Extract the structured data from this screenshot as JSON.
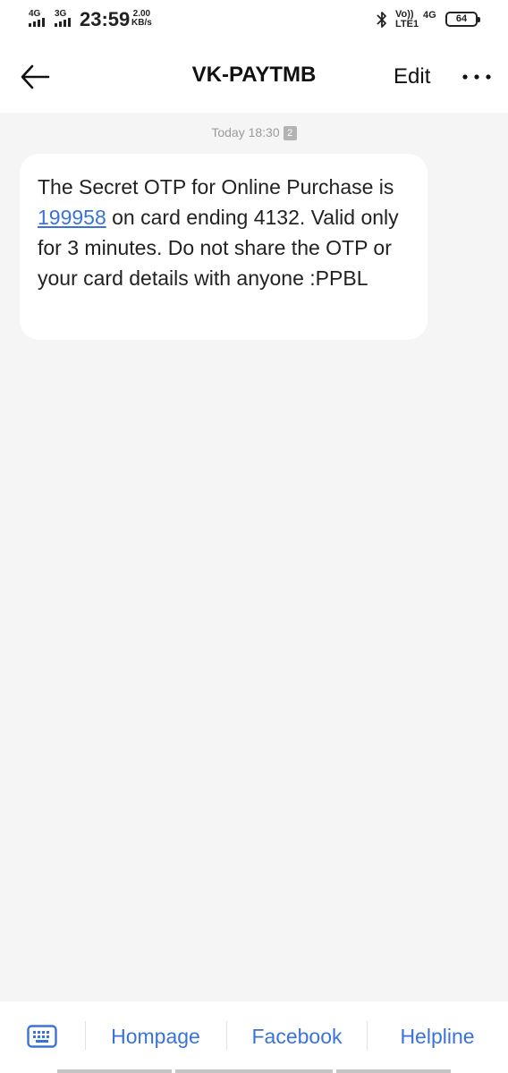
{
  "status_bar": {
    "sim1_network": "4G",
    "sim2_network": "3G",
    "time": "23:59",
    "speed_value": "2.00",
    "speed_unit": "KB/s",
    "volte_top": "Vo))",
    "volte_bottom": "LTE1",
    "sim_right_network": "4G",
    "battery": "64"
  },
  "header": {
    "title": "VK-PAYTMB",
    "edit_label": "Edit"
  },
  "conversation": {
    "timestamp": "Today 18:30",
    "sim_badge": "2",
    "message": {
      "text_before": "The Secret OTP for Online Purchase is ",
      "otp": "199958",
      "text_after": " on card ending 4132. Valid only for 3 minutes. Do not share the OTP or your card details with anyone :PPBL"
    }
  },
  "bottom_menu": {
    "items": [
      {
        "label": "Hompage"
      },
      {
        "label": "Facebook"
      },
      {
        "label": "Helpline"
      }
    ]
  },
  "colors": {
    "accent": "#3b72d9",
    "background": "#f5f5f5",
    "bubble": "#ffffff"
  },
  "icons": [
    "back-arrow-icon",
    "more-icon",
    "keyboard-icon",
    "bluetooth-icon",
    "battery-icon",
    "signal-icon"
  ]
}
